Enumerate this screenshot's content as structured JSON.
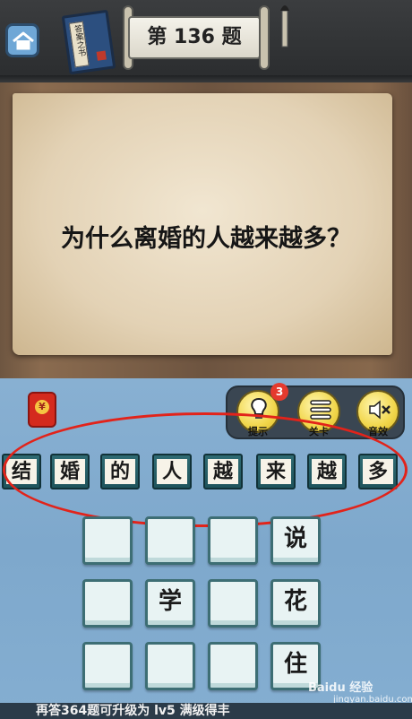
{
  "header": {
    "level_title": "第 136 题",
    "book_label": "答案之书"
  },
  "question": {
    "text": "为什么离婚的人越来越多？"
  },
  "tools": [
    {
      "name": "hint",
      "label": "提示",
      "badge": "3"
    },
    {
      "name": "levels",
      "label": "关卡"
    },
    {
      "name": "sound",
      "label": "音效"
    }
  ],
  "red_packet": {
    "symbol": "¥"
  },
  "candidate_tiles": [
    "结",
    "婚",
    "的",
    "人",
    "越",
    "来",
    "越",
    "多"
  ],
  "answer_grid": [
    [
      "",
      "",
      "",
      "说"
    ],
    [
      "",
      "学",
      "",
      "花"
    ],
    [
      "",
      "",
      "",
      "住"
    ]
  ],
  "footer": {
    "text": "再答364题可升级为 lv5 满级得丰"
  },
  "watermark": {
    "text": "Baidu 经验",
    "sub": "jingyan.baidu.com"
  },
  "colors": {
    "highlight_oval": "#e2231a",
    "tile": "#2f6b73",
    "badge": "#e53a2e"
  }
}
